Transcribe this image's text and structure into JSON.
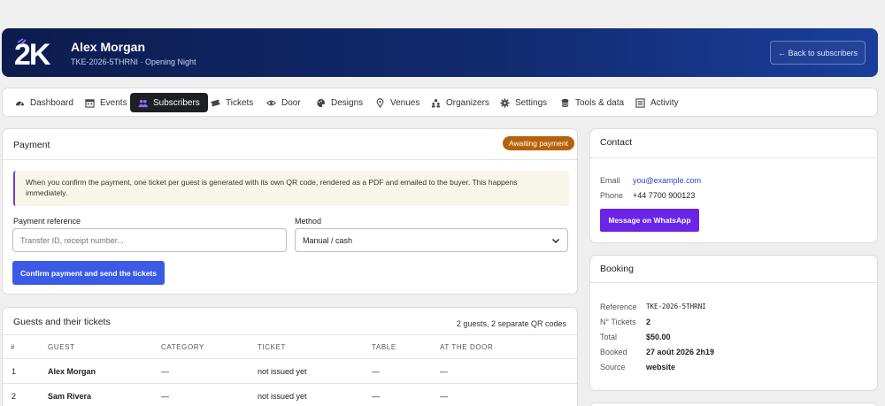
{
  "header": {
    "logo_text": "2K",
    "name": "Alex Morgan",
    "subtitle": "TKE-2026-5THRNI · Opening Night",
    "back_label": "← Back to subscribers"
  },
  "nav": {
    "items": [
      {
        "label": "Dashboard",
        "icon": "gauge-icon",
        "active": false
      },
      {
        "label": "Events",
        "icon": "calendar-icon",
        "active": false
      },
      {
        "label": "Subscribers",
        "icon": "users-icon",
        "active": true
      },
      {
        "label": "Tickets",
        "icon": "ticket-icon",
        "active": false
      },
      {
        "label": "Door",
        "icon": "eye-icon",
        "active": false
      },
      {
        "label": "Designs",
        "icon": "palette-icon",
        "active": false
      },
      {
        "label": "Venues",
        "icon": "map-pin-icon",
        "active": false
      },
      {
        "label": "Organizers",
        "icon": "people-icon",
        "active": false
      },
      {
        "label": "Settings",
        "icon": "gear-icon",
        "active": false
      },
      {
        "label": "Tools & data",
        "icon": "database-icon",
        "active": false
      },
      {
        "label": "Activity",
        "icon": "list-icon",
        "active": false
      }
    ]
  },
  "payment": {
    "title": "Payment",
    "status_badge": "Awaiting payment",
    "notice": "When you confirm the payment, one ticket per guest is generated with its own QR code, rendered as a PDF and emailed to the buyer. This happens immediately.",
    "reference_label": "Payment reference",
    "reference_placeholder": "Transfer ID, receipt number...",
    "method_label": "Method",
    "method_value": "Manual / cash",
    "confirm_label": "Confirm payment and send the tickets"
  },
  "guests": {
    "title": "Guests and their tickets",
    "summary": "2 guests, 2 separate QR codes",
    "columns": [
      "#",
      "GUEST",
      "CATEGORY",
      "TICKET",
      "TABLE",
      "AT THE DOOR"
    ],
    "rows": [
      [
        "1",
        "Alex Morgan",
        "—",
        "not issued yet",
        "—",
        "—"
      ],
      [
        "2",
        "Sam Rivera",
        "—",
        "not issued yet",
        "—",
        "—"
      ]
    ]
  },
  "contact": {
    "title": "Contact",
    "email_label": "Email",
    "email_value": "you@example.com",
    "phone_label": "Phone",
    "phone_value": "+44 7700 900123",
    "whatsapp_label": "Message on WhatsApp"
  },
  "booking": {
    "title": "Booking",
    "rows": [
      {
        "label": "Reference",
        "value": "TKE-2026-5THRNI"
      },
      {
        "label": "N° Tickets",
        "value": "2"
      },
      {
        "label": "Total",
        "value": "$50.00"
      },
      {
        "label": "Booked",
        "value": "27 août 2026 2h19"
      },
      {
        "label": "Source",
        "value": "website"
      }
    ]
  },
  "colors": {
    "accent": "#3b5be7",
    "badge": "#b7620b",
    "whatsapp": "#6a25e8",
    "hero_start": "#0c1c4e",
    "hero_end": "#1a3e9a"
  }
}
